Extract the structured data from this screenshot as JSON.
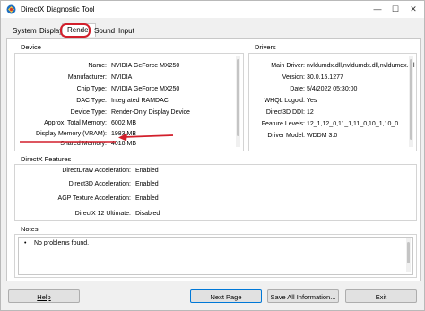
{
  "window": {
    "title": "DirectX Diagnostic Tool",
    "minimize": "—",
    "maximize": "☐",
    "close": "✕"
  },
  "tabs": [
    {
      "label": "System"
    },
    {
      "label": "Display"
    },
    {
      "label": "Render",
      "active": true
    },
    {
      "label": "Sound"
    },
    {
      "label": "Input"
    }
  ],
  "device": {
    "heading": "Device",
    "rows": [
      {
        "label": "Name:",
        "value": "NVIDIA GeForce MX250"
      },
      {
        "label": "Manufacturer:",
        "value": "NVIDIA"
      },
      {
        "label": "Chip Type:",
        "value": "NVIDIA GeForce MX250"
      },
      {
        "label": "DAC Type:",
        "value": "Integrated RAMDAC"
      },
      {
        "label": "Device Type:",
        "value": "Render-Only Display Device"
      },
      {
        "label": "Approx. Total Memory:",
        "value": "6002 MB"
      },
      {
        "label": "Display Memory (VRAM):",
        "value": "1983 MB"
      },
      {
        "label": "Shared Memory:",
        "value": "4018 MB"
      }
    ]
  },
  "drivers": {
    "heading": "Drivers",
    "rows": [
      {
        "label": "Main Driver:",
        "value": "nvldumdx.dll,nvldumdx.dll,nvldumdx.dll"
      },
      {
        "label": "Version:",
        "value": "30.0.15.1277"
      },
      {
        "label": "Date:",
        "value": "5/4/2022 05:30:00"
      },
      {
        "label": "WHQL Logo'd:",
        "value": "Yes"
      },
      {
        "label": "Direct3D DDI:",
        "value": "12"
      },
      {
        "label": "Feature Levels:",
        "value": "12_1,12_0,11_1,11_0,10_1,10_0"
      },
      {
        "label": "Driver Model:",
        "value": "WDDM 3.0"
      }
    ]
  },
  "features": {
    "heading": "DirectX Features",
    "rows": [
      {
        "label": "DirectDraw Acceleration:",
        "value": "Enabled"
      },
      {
        "label": "Direct3D Acceleration:",
        "value": "Enabled"
      },
      {
        "label": "AGP Texture Acceleration:",
        "value": "Enabled"
      },
      {
        "label": "DirectX 12 Ultimate:",
        "value": "Disabled"
      }
    ]
  },
  "notes": {
    "heading": "Notes",
    "items": [
      "No problems found."
    ]
  },
  "buttons": {
    "help": "Help",
    "next_page": "Next Page",
    "save_all": "Save All Information...",
    "exit": "Exit"
  },
  "colors": {
    "highlight": "#d21f2b"
  }
}
